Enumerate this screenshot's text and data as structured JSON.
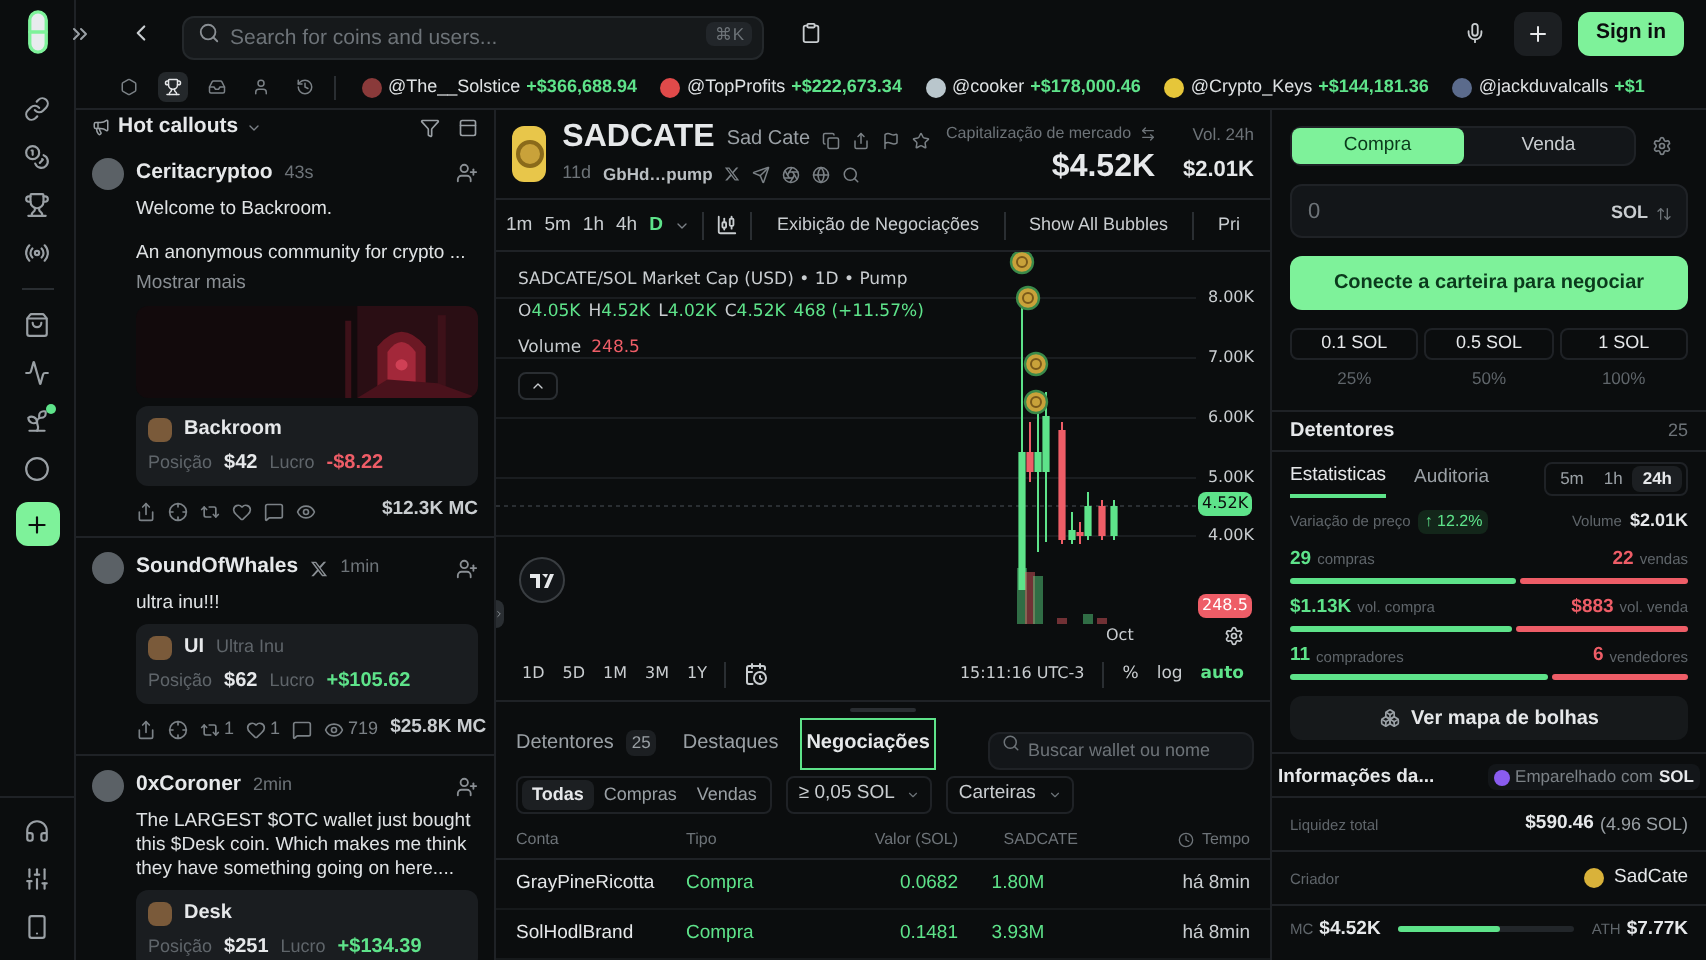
{
  "topbar": {
    "search_placeholder": "Search for coins and users...",
    "shortcut": "⌘K",
    "sign_in": "Sign in"
  },
  "ticker_filters": [
    {
      "selected": false
    },
    {
      "selected": true
    },
    {
      "selected": false
    },
    {
      "selected": false
    },
    {
      "selected": false
    }
  ],
  "ticker": [
    {
      "handle": "@The__Solstice",
      "amount": "+$366,688.94",
      "color": "#8a3a3a"
    },
    {
      "handle": "@TopProfits",
      "amount": "+$222,673.34",
      "color": "#e04a4a"
    },
    {
      "handle": "@cooker",
      "amount": "+$178,000.46",
      "color": "#b9c6cc"
    },
    {
      "handle": "@Crypto_Keys",
      "amount": "+$144,181.36",
      "color": "#e6c63a"
    },
    {
      "handle": "@jackduvalcalls",
      "amount": "+$1",
      "color": "#5b6b8c"
    }
  ],
  "feed": {
    "title": "Hot callouts",
    "posts": [
      {
        "author": "Ceritacryptoo",
        "time": "43s",
        "x_badge": false,
        "paragraphs": [
          "Welcome to Backroom.",
          "An anonymous community for crypto ..."
        ],
        "more": "Mostrar mais",
        "image": {
          "kind": "picture"
        },
        "token": {
          "name": "Backroom",
          "position_label": "Posição",
          "position": "$42",
          "profit_label": "Lucro",
          "profit": "-$8.22",
          "gain": false
        },
        "actions": [
          {
            "kind": "share"
          },
          {
            "kind": "target"
          },
          {
            "kind": "repost"
          },
          {
            "kind": "like"
          },
          {
            "kind": "comment"
          },
          {
            "kind": "views"
          }
        ],
        "mc": "$12.3K MC"
      },
      {
        "author": "SoundOfWhales",
        "time": "1min",
        "x_badge": true,
        "paragraphs": [
          "ultra inu!!!"
        ],
        "token": {
          "name": "UI",
          "subtitle": "Ultra Inu",
          "position_label": "Posição",
          "position": "$62",
          "profit_label": "Lucro",
          "profit": "+$105.62",
          "gain": true
        },
        "actions": [
          {
            "kind": "share"
          },
          {
            "kind": "target"
          },
          {
            "kind": "repost",
            "count": "1"
          },
          {
            "kind": "like",
            "count": "1"
          },
          {
            "kind": "comment"
          },
          {
            "kind": "views",
            "count": "719"
          }
        ],
        "mc": "$25.8K MC"
      },
      {
        "author": "0xCoroner",
        "time": "2min",
        "x_badge": false,
        "paragraphs": [
          "The LARGEST $OTC wallet just bought this $Desk coin. Which makes me think they have something going on here...."
        ],
        "token": {
          "name": "Desk",
          "position_label": "Posição",
          "position": "$251",
          "profit_label": "Lucro",
          "profit": "+$134.39",
          "gain": true
        }
      }
    ]
  },
  "coin": {
    "symbol": "SADCATE",
    "name": "Sad Cate",
    "age": "11d",
    "address": "GbHd…pump",
    "mcap_label": "Capitalização de mercado",
    "mcap": "$4.52K",
    "vol_label": "Vol. 24h",
    "vol": "$2.01K"
  },
  "timeframes": [
    {
      "label": "1m",
      "selected": false
    },
    {
      "label": "5m",
      "selected": false
    },
    {
      "label": "1h",
      "selected": false
    },
    {
      "label": "4h",
      "selected": false
    },
    {
      "label": "D",
      "selected": true
    }
  ],
  "chart_toolbar": [
    "Exibição de Negociações",
    "Show All Bubbles",
    "Pri"
  ],
  "chart": {
    "legend": "SADCATE/SOL Market Cap (USD) • 1D • Pump",
    "ohlc": [
      {
        "label": "O",
        "value": "4.05K"
      },
      {
        "label": "H",
        "value": "4.52K"
      },
      {
        "label": "L",
        "value": "4.02K"
      },
      {
        "label": "C",
        "value": "4.52K"
      }
    ],
    "change": "468 (+11.57%)",
    "volume_label": "Volume",
    "volume": "248.5",
    "yticks": [
      "8.00K",
      "7.00K",
      "6.00K",
      "5.00K",
      "4.00K"
    ],
    "price_tag": "4.52K",
    "volume_tag": "248.5",
    "xlabel": "Oct"
  },
  "ranges": [
    "1D",
    "5D",
    "1M",
    "3M",
    "1Y"
  ],
  "chart_footer": {
    "time": "15:11:16 UTC-3",
    "options": [
      {
        "label": "%",
        "selected": false
      },
      {
        "label": "log",
        "selected": false
      },
      {
        "label": "auto",
        "selected": true
      }
    ]
  },
  "bottom_tabs": [
    {
      "label": "Detentores",
      "count": "25",
      "selected": false
    },
    {
      "label": "Destaques",
      "selected": false
    },
    {
      "label": "Negociações",
      "selected": true
    }
  ],
  "trade_search_placeholder": "Buscar wallet ou nome",
  "trade_filters": [
    {
      "label": "Todas",
      "selected": true
    },
    {
      "label": "Compras",
      "selected": false
    },
    {
      "label": "Vendas",
      "selected": false
    }
  ],
  "dropdowns": [
    "≥ 0,05 SOL",
    "Carteiras"
  ],
  "table": {
    "columns": [
      "Conta",
      "Tipo",
      "Valor (SOL)",
      "SADCATE",
      "Tempo"
    ],
    "rows": [
      {
        "account": "GrayPineRicotta",
        "type": "Compra",
        "value": "0.0682",
        "amount": "1.80M",
        "time": "há 8min"
      },
      {
        "account": "SolHodlBrand",
        "type": "Compra",
        "value": "0.1481",
        "amount": "3.93M",
        "time": "há 8min"
      }
    ]
  },
  "trade": {
    "sides": [
      {
        "label": "Compra",
        "selected": true
      },
      {
        "label": "Venda",
        "selected": false
      }
    ],
    "amount_placeholder": "0",
    "unit": "SOL",
    "connect": "Conecte a carteira para negociar",
    "presets": [
      "0.1 SOL",
      "0.5 SOL",
      "1 SOL"
    ],
    "percents": [
      "25%",
      "50%",
      "100%"
    ]
  },
  "holders": {
    "label": "Detentores",
    "count": "25"
  },
  "stats": {
    "tabs": [
      {
        "label": "Estatisticas",
        "selected": true
      },
      {
        "label": "Auditoria",
        "selected": false
      }
    ],
    "ranges": [
      {
        "label": "5m",
        "selected": false
      },
      {
        "label": "1h",
        "selected": false
      },
      {
        "label": "24h",
        "selected": true
      }
    ],
    "change_label": "Variação de preço",
    "change": "↑ 12.2%",
    "volume_label": "Volume",
    "volume": "$2.01K",
    "rows": [
      {
        "buy": "29",
        "buy_label": "compras",
        "sell": "22",
        "sell_label": "vendas",
        "level": 0.57
      },
      {
        "buy": "$1.13K",
        "buy_label": "vol. compra",
        "sell": "$883",
        "sell_label": "vol. venda",
        "level": 0.56
      },
      {
        "buy": "11",
        "buy_label": "compradores",
        "sell": "6",
        "sell_label": "vendedores",
        "level": 0.65
      }
    ],
    "bubbles": "Ver mapa de bolhas"
  },
  "info": {
    "title": "Informações da...",
    "pair_label": "Emparelhado com",
    "pair": "SOL",
    "liquidity_label": "Liquidez total",
    "liquidity": "$590.46",
    "liquidity_sol": "(4.96 SOL)",
    "creator_label": "Criador",
    "creator": "SadCate",
    "mc_label": "MC",
    "mc": "$4.52K",
    "mc_progress": {
      "level": 0.58
    },
    "ath_label": "ATH",
    "ath": "$7.77K"
  }
}
